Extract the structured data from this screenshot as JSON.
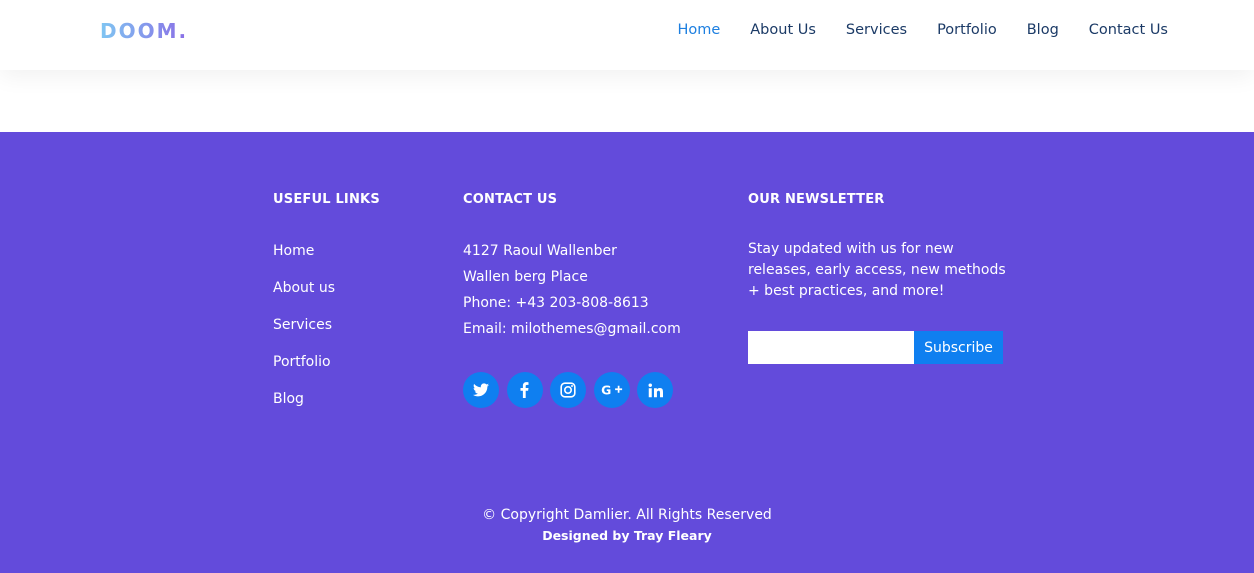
{
  "header": {
    "logo_text": "DOOM.",
    "nav": [
      {
        "label": "Home",
        "active": true
      },
      {
        "label": "About Us",
        "active": false
      },
      {
        "label": "Services",
        "active": false
      },
      {
        "label": "Portfolio",
        "active": false
      },
      {
        "label": "Blog",
        "active": false
      },
      {
        "label": "Contact Us",
        "active": false
      }
    ]
  },
  "footer": {
    "useful_links": {
      "title": "USEFUL LINKS",
      "items": [
        "Home",
        "About us",
        "Services",
        "Portfolio",
        "Blog"
      ]
    },
    "contact": {
      "title": "CONTACT US",
      "address_line1": "4127 Raoul Wallenber",
      "address_line2": "Wallen berg Place",
      "phone": "Phone: +43 203-808-8613",
      "email": "Email: milothemes@gmail.com",
      "socials": [
        "twitter-icon",
        "facebook-icon",
        "instagram-icon",
        "google-plus-icon",
        "linkedin-icon"
      ]
    },
    "newsletter": {
      "title": "OUR NEWSLETTER",
      "text": "Stay updated with us for new releases, early access, new methods + best practices, and more!",
      "input_placeholder": "",
      "subscribe_label": "Subscribe"
    },
    "copyright": "© Copyright Damlier. All Rights Reserved",
    "designed_by": "Designed by Tray Fleary"
  },
  "colors": {
    "footer_bg": "#634bdb",
    "accent_blue": "#0f7ff0",
    "nav_text": "#1b3a66",
    "nav_active": "#1d7fe0"
  }
}
